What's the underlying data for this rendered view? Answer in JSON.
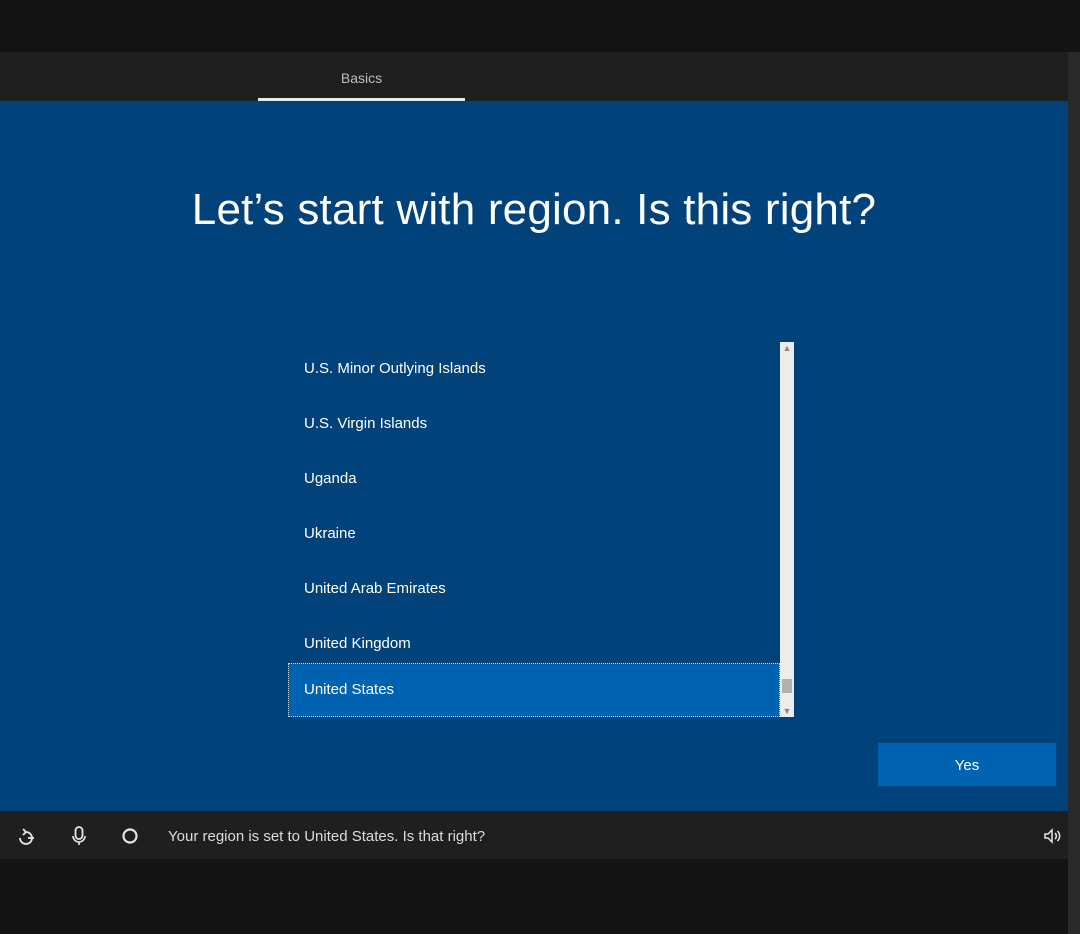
{
  "tabs": [
    {
      "label": "Basics",
      "active": true
    }
  ],
  "main": {
    "title": "Let’s start with region. Is this right?"
  },
  "region_list": {
    "items": [
      {
        "label": "U.S. Minor Outlying Islands",
        "selected": false
      },
      {
        "label": "U.S. Virgin Islands",
        "selected": false
      },
      {
        "label": "Uganda",
        "selected": false
      },
      {
        "label": "Ukraine",
        "selected": false
      },
      {
        "label": "United Arab Emirates",
        "selected": false
      },
      {
        "label": "United Kingdom",
        "selected": false
      },
      {
        "label": "United States",
        "selected": true
      }
    ]
  },
  "buttons": {
    "yes_label": "Yes"
  },
  "bottom_bar": {
    "status_text": "Your region is set to United States. Is that right?",
    "icons": [
      "ease-of-access-icon",
      "microphone-icon",
      "cortana-circle-icon",
      "speaker-volume-icon"
    ]
  },
  "colors": {
    "background_blue": "#02427a",
    "accent_blue": "#0063b1",
    "bar_dark": "#1f1f1f"
  }
}
